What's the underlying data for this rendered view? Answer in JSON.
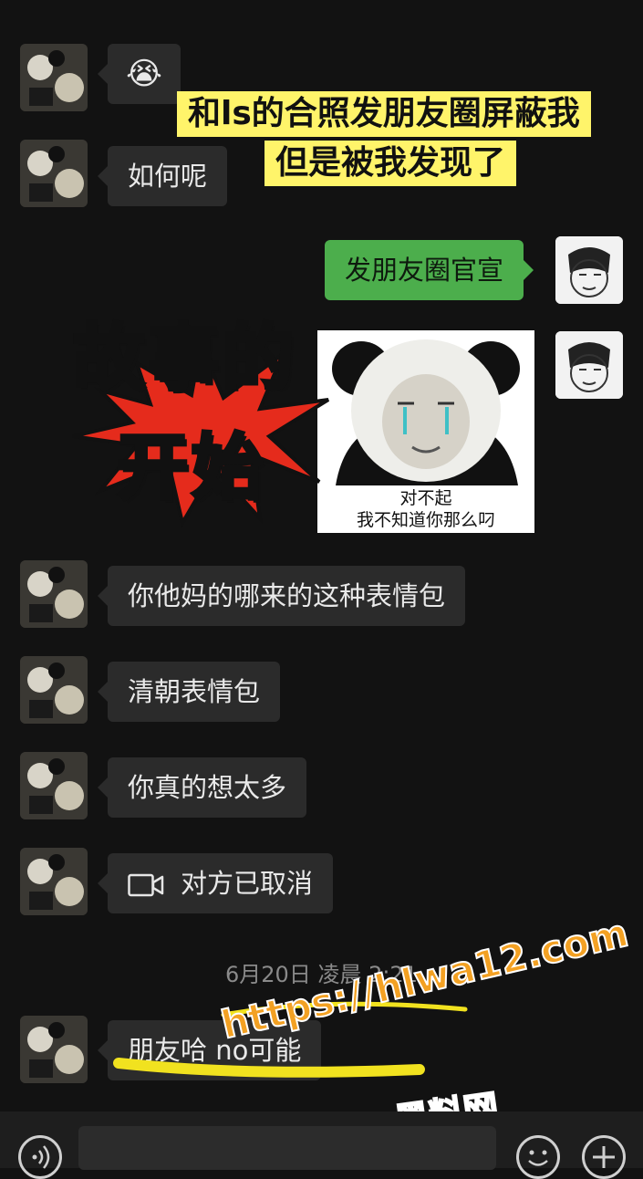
{
  "overlay": {
    "caption_line1": "和ls的合照发朋友圈屏蔽我",
    "caption_line2": "但是被我发现了",
    "story_line1": "故事的",
    "story_line2": "开始"
  },
  "messages": {
    "m1_emoji": "😭",
    "m2_text": "如何呢",
    "m3_text": "发朋友圈官宣",
    "m4_sticker_line1": "对不起",
    "m4_sticker_line2": "我不知道你那么叼",
    "m5_text": "你他妈的哪来的这种表情包",
    "m6_text": "清朝表情包",
    "m7_text": "你真的想太多",
    "m8_call_text": "对方已取消",
    "m9_text": "朋友哈 no可能"
  },
  "timestamp": "6月20日 凌晨 2:21",
  "watermark": {
    "url": "https://hlwa12.com",
    "site": "黑料网"
  },
  "icons": {
    "voice": "voice-icon",
    "emoji": "emoji-icon",
    "plus": "plus-icon",
    "video_call": "video-call-icon"
  },
  "colors": {
    "background": "#121212",
    "bubble_other": "#2b2b2b",
    "bubble_self": "#4cae4c",
    "caption_yellow": "#fff46a",
    "story_yellow": "#ffe81a",
    "watermark_orange": "#f3a123"
  }
}
